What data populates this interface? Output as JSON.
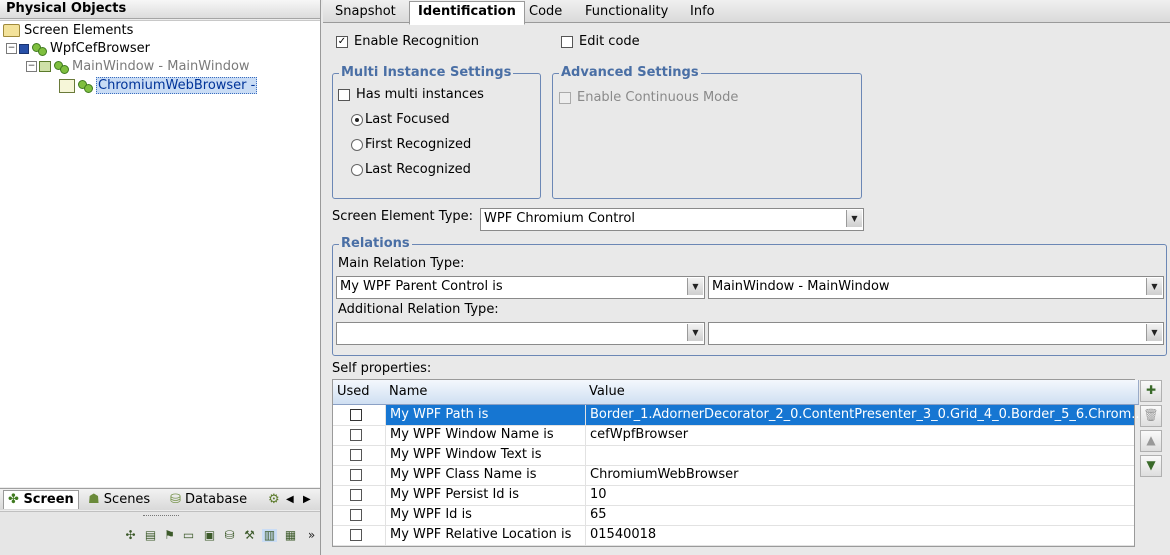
{
  "left": {
    "header": "Physical Objects",
    "tree": {
      "root": "Screen Elements",
      "app": "WpfCefBrowser",
      "window": "MainWindow - MainWindow",
      "selected": "ChromiumWebBrowser -"
    },
    "tabs": [
      {
        "label": "Screen",
        "icon": "screen-icon"
      },
      {
        "label": "Scenes",
        "icon": "scenes-icon"
      },
      {
        "label": "Database",
        "icon": "database-icon"
      }
    ],
    "tab_scroll_icons": [
      "gear-icon",
      "arrow-left-icon",
      "arrow-right-icon"
    ],
    "toolbar_icons": [
      "group-icon",
      "form-icon",
      "flag-icon",
      "chat-icon",
      "screen-icon",
      "cylinder-icon",
      "tools-icon",
      "window-icon",
      "window-alt-icon",
      "more-icon"
    ]
  },
  "tabs": [
    "Snapshot",
    "Identification",
    "Code",
    "Functionality",
    "Info"
  ],
  "active_tab": "Identification",
  "enable_recognition": {
    "label": "Enable Recognition",
    "checked": true
  },
  "edit_code": {
    "label": "Edit code",
    "checked": false
  },
  "multi": {
    "title": "Multi Instance Settings",
    "has_multi": "Has multi instances",
    "options": [
      "Last Focused",
      "First Recognized",
      "Last Recognized"
    ],
    "selected": "Last Focused"
  },
  "advanced": {
    "title": "Advanced Settings",
    "continuous": "Enable Continuous Mode"
  },
  "element_type": {
    "label": "Screen Element Type:",
    "value": "WPF Chromium Control"
  },
  "relations": {
    "title": "Relations",
    "main_label": "Main Relation Type:",
    "main_type": "My WPF Parent Control is",
    "main_value": "MainWindow - MainWindow",
    "additional_label": "Additional Relation Type:",
    "additional_type": "",
    "additional_value": ""
  },
  "self_props": {
    "label": "Self properties:",
    "columns": [
      "Used",
      "Name",
      "Value"
    ],
    "rows": [
      {
        "used": true,
        "name": "My WPF Path is",
        "value": "Border_1.AdornerDecorator_2_0.ContentPresenter_3_0.Grid_4_0.Border_5_6.Chrom..."
      },
      {
        "used": false,
        "name": "My WPF Window Name is",
        "value": "cefWpfBrowser"
      },
      {
        "used": false,
        "name": "My WPF Window Text is",
        "value": ""
      },
      {
        "used": false,
        "name": "My WPF Class Name is",
        "value": "ChromiumWebBrowser"
      },
      {
        "used": false,
        "name": "My WPF Persist Id is",
        "value": "10"
      },
      {
        "used": false,
        "name": "My WPF Id is",
        "value": "65"
      },
      {
        "used": false,
        "name": "My WPF Relative Location is",
        "value": "01540018"
      }
    ],
    "side_buttons": [
      "add-icon",
      "delete-icon",
      "move-up-icon",
      "move-down-icon"
    ]
  },
  "colors": {
    "selection": "#1676d2",
    "group_border": "#6b87b5",
    "group_title": "#4a6fa5"
  }
}
